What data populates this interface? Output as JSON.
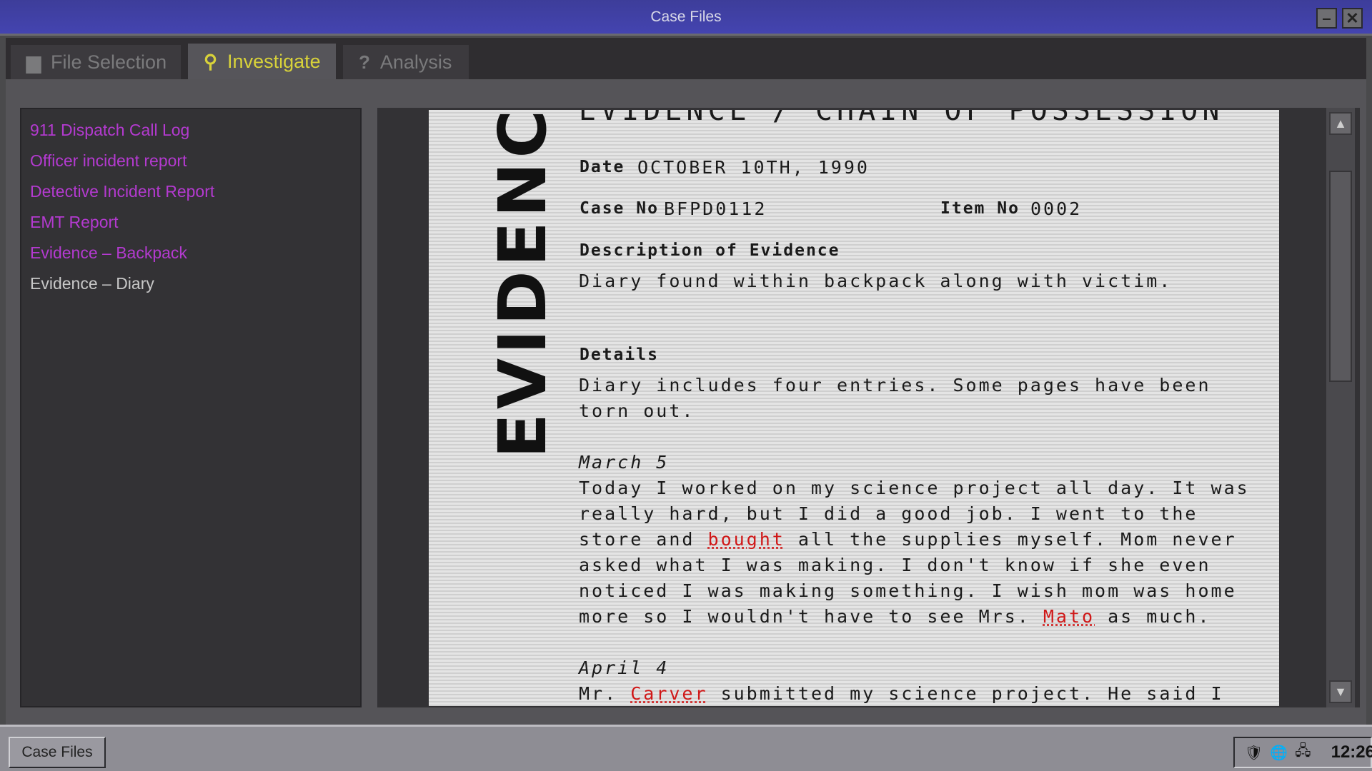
{
  "window": {
    "title": "Case Files",
    "minimize": "–",
    "close": "✕"
  },
  "tabs": [
    {
      "label": "File Selection",
      "icon": "folder-icon",
      "glyph": "▆"
    },
    {
      "label": "Investigate",
      "icon": "search-icon",
      "glyph": "⚲"
    },
    {
      "label": "Analysis",
      "icon": "question-icon",
      "glyph": "?"
    }
  ],
  "files": [
    "911 Dispatch Call Log",
    "Officer incident report",
    "Detective Incident Report",
    "EMT Report",
    "Evidence – Backpack",
    "Evidence – Diary"
  ],
  "document": {
    "vertical_title": "EVIDENCE",
    "heading": "EVIDENCE / CHAIN OF POSSESSION",
    "date_label": "Date",
    "date": "OCTOBER 10TH, 1990",
    "case_label": "Case No",
    "case": "BFPD0112",
    "item_label": "Item No",
    "item": "0002",
    "desc_label": "Description of Evidence",
    "desc": "Diary found within backpack along with victim.",
    "details_label": "Details",
    "details": [
      "Diary includes four entries. Some pages have been",
      "torn out."
    ],
    "entry1_date": "March 5",
    "entry1": {
      "l1": "Today I worked on my science project all day. It was",
      "l2": "really hard, but I did a good job. I went to the",
      "l3a": "store and ",
      "l3h": "bought",
      "l3b": " all the supplies myself. Mom never",
      "l4": "asked what I was making. I don't know if she even",
      "l5": "noticed I was making something. I wish mom was home",
      "l6a": "more so I wouldn't have to see Mrs. ",
      "l6h": "Mato",
      "l6b": " as much."
    },
    "entry2_date": "April 4",
    "entry2": {
      "l1a": "Mr. ",
      "l1h": "Carver",
      "l1b": " submitted my science project. He said I"
    }
  },
  "scrollbar": {
    "up": "▲",
    "down": "▼"
  },
  "taskbar": {
    "button": "Case Files",
    "tray": [
      "🛡",
      "🌐",
      "🖧"
    ],
    "clock": "12:26"
  }
}
